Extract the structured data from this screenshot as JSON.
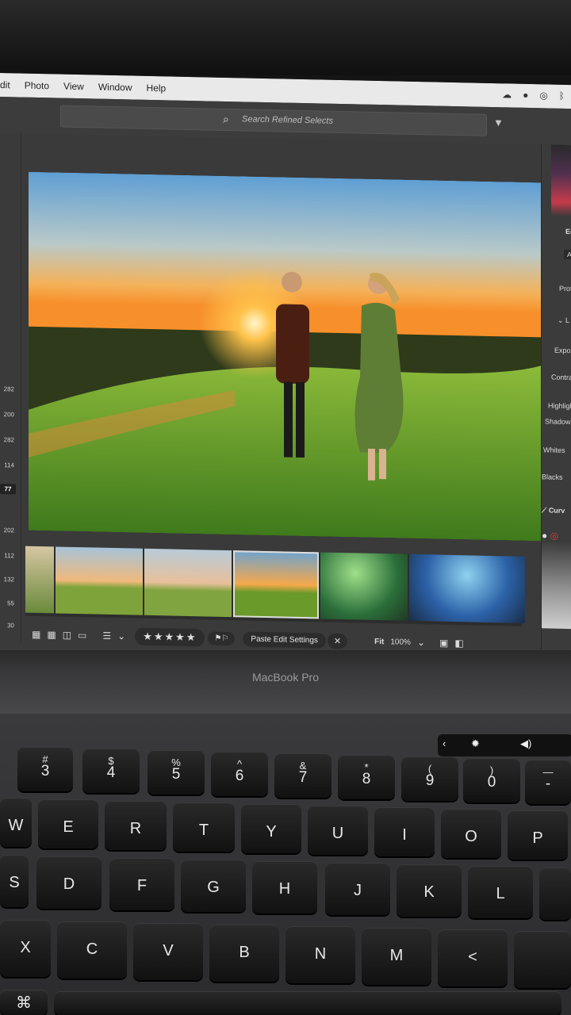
{
  "menubar": {
    "items": [
      "dit",
      "Photo",
      "View",
      "Window",
      "Help"
    ]
  },
  "search": {
    "placeholder": "Search Refined Selects"
  },
  "left_panel": {
    "numbers": [
      "282",
      "200",
      "282",
      "114",
      "77",
      "202",
      "112",
      "132",
      "55",
      "30"
    ],
    "selected": "77"
  },
  "right_panel": {
    "labels": [
      "Ed",
      "A",
      "Prof",
      "L",
      "Expos",
      "Contra",
      "Highligh",
      "Shadows",
      "Whites",
      "Blacks",
      "Curv"
    ]
  },
  "toolbar": {
    "stars": "★★★★★",
    "paste_label": "Paste Edit Settings",
    "close_glyph": "✕",
    "fit_label": "Fit",
    "zoom_label": "100%"
  },
  "laptop": {
    "brand": "MacBook Pro"
  },
  "keyboard": {
    "number_row": [
      {
        "sym": "#",
        "ch": "3"
      },
      {
        "sym": "$",
        "ch": "4"
      },
      {
        "sym": "%",
        "ch": "5"
      },
      {
        "sym": "^",
        "ch": "6"
      },
      {
        "sym": "&",
        "ch": "7"
      },
      {
        "sym": "*",
        "ch": "8"
      },
      {
        "sym": "(",
        "ch": "9"
      },
      {
        "sym": ")",
        "ch": "0"
      },
      {
        "sym": "—",
        "ch": "-"
      }
    ],
    "top_row": [
      "W",
      "E",
      "R",
      "T",
      "Y",
      "U",
      "I",
      "O",
      "P"
    ],
    "home_row": [
      "S",
      "D",
      "F",
      "G",
      "H",
      "J",
      "K",
      "L"
    ],
    "bottom_row": [
      "X",
      "C",
      "V",
      "B",
      "N",
      "M",
      "<"
    ]
  },
  "colors": {
    "screen_bg": "#3a3a3a",
    "menubar_bg": "#e9e9ea",
    "key_bg": "#1a1a1a",
    "sky_top": "#6fa8d6",
    "sun": "#ffb43a"
  },
  "icons": [
    "search-icon",
    "filter-icon",
    "grid-view-icon",
    "sort-icon",
    "flag-icon",
    "compare-icon",
    "cloud-icon",
    "bluetooth-icon"
  ]
}
